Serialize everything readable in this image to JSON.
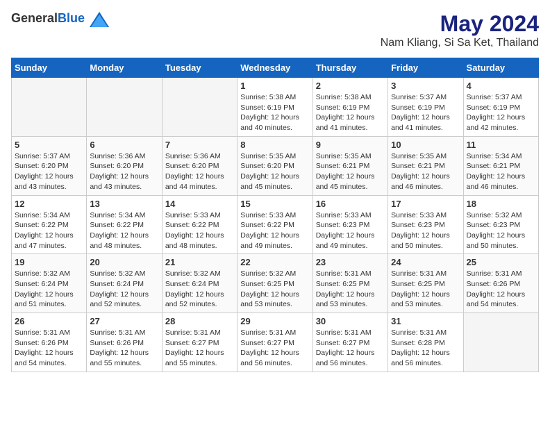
{
  "header": {
    "logo_general": "General",
    "logo_blue": "Blue",
    "month_title": "May 2024",
    "location": "Nam Kliang, Si Sa Ket, Thailand"
  },
  "weekdays": [
    "Sunday",
    "Monday",
    "Tuesday",
    "Wednesday",
    "Thursday",
    "Friday",
    "Saturday"
  ],
  "weeks": [
    [
      {
        "day": "",
        "info": ""
      },
      {
        "day": "",
        "info": ""
      },
      {
        "day": "",
        "info": ""
      },
      {
        "day": "1",
        "info": "Sunrise: 5:38 AM\nSunset: 6:19 PM\nDaylight: 12 hours\nand 40 minutes."
      },
      {
        "day": "2",
        "info": "Sunrise: 5:38 AM\nSunset: 6:19 PM\nDaylight: 12 hours\nand 41 minutes."
      },
      {
        "day": "3",
        "info": "Sunrise: 5:37 AM\nSunset: 6:19 PM\nDaylight: 12 hours\nand 41 minutes."
      },
      {
        "day": "4",
        "info": "Sunrise: 5:37 AM\nSunset: 6:19 PM\nDaylight: 12 hours\nand 42 minutes."
      }
    ],
    [
      {
        "day": "5",
        "info": "Sunrise: 5:37 AM\nSunset: 6:20 PM\nDaylight: 12 hours\nand 43 minutes."
      },
      {
        "day": "6",
        "info": "Sunrise: 5:36 AM\nSunset: 6:20 PM\nDaylight: 12 hours\nand 43 minutes."
      },
      {
        "day": "7",
        "info": "Sunrise: 5:36 AM\nSunset: 6:20 PM\nDaylight: 12 hours\nand 44 minutes."
      },
      {
        "day": "8",
        "info": "Sunrise: 5:35 AM\nSunset: 6:20 PM\nDaylight: 12 hours\nand 45 minutes."
      },
      {
        "day": "9",
        "info": "Sunrise: 5:35 AM\nSunset: 6:21 PM\nDaylight: 12 hours\nand 45 minutes."
      },
      {
        "day": "10",
        "info": "Sunrise: 5:35 AM\nSunset: 6:21 PM\nDaylight: 12 hours\nand 46 minutes."
      },
      {
        "day": "11",
        "info": "Sunrise: 5:34 AM\nSunset: 6:21 PM\nDaylight: 12 hours\nand 46 minutes."
      }
    ],
    [
      {
        "day": "12",
        "info": "Sunrise: 5:34 AM\nSunset: 6:22 PM\nDaylight: 12 hours\nand 47 minutes."
      },
      {
        "day": "13",
        "info": "Sunrise: 5:34 AM\nSunset: 6:22 PM\nDaylight: 12 hours\nand 48 minutes."
      },
      {
        "day": "14",
        "info": "Sunrise: 5:33 AM\nSunset: 6:22 PM\nDaylight: 12 hours\nand 48 minutes."
      },
      {
        "day": "15",
        "info": "Sunrise: 5:33 AM\nSunset: 6:22 PM\nDaylight: 12 hours\nand 49 minutes."
      },
      {
        "day": "16",
        "info": "Sunrise: 5:33 AM\nSunset: 6:23 PM\nDaylight: 12 hours\nand 49 minutes."
      },
      {
        "day": "17",
        "info": "Sunrise: 5:33 AM\nSunset: 6:23 PM\nDaylight: 12 hours\nand 50 minutes."
      },
      {
        "day": "18",
        "info": "Sunrise: 5:32 AM\nSunset: 6:23 PM\nDaylight: 12 hours\nand 50 minutes."
      }
    ],
    [
      {
        "day": "19",
        "info": "Sunrise: 5:32 AM\nSunset: 6:24 PM\nDaylight: 12 hours\nand 51 minutes."
      },
      {
        "day": "20",
        "info": "Sunrise: 5:32 AM\nSunset: 6:24 PM\nDaylight: 12 hours\nand 52 minutes."
      },
      {
        "day": "21",
        "info": "Sunrise: 5:32 AM\nSunset: 6:24 PM\nDaylight: 12 hours\nand 52 minutes."
      },
      {
        "day": "22",
        "info": "Sunrise: 5:32 AM\nSunset: 6:25 PM\nDaylight: 12 hours\nand 53 minutes."
      },
      {
        "day": "23",
        "info": "Sunrise: 5:31 AM\nSunset: 6:25 PM\nDaylight: 12 hours\nand 53 minutes."
      },
      {
        "day": "24",
        "info": "Sunrise: 5:31 AM\nSunset: 6:25 PM\nDaylight: 12 hours\nand 53 minutes."
      },
      {
        "day": "25",
        "info": "Sunrise: 5:31 AM\nSunset: 6:26 PM\nDaylight: 12 hours\nand 54 minutes."
      }
    ],
    [
      {
        "day": "26",
        "info": "Sunrise: 5:31 AM\nSunset: 6:26 PM\nDaylight: 12 hours\nand 54 minutes."
      },
      {
        "day": "27",
        "info": "Sunrise: 5:31 AM\nSunset: 6:26 PM\nDaylight: 12 hours\nand 55 minutes."
      },
      {
        "day": "28",
        "info": "Sunrise: 5:31 AM\nSunset: 6:27 PM\nDaylight: 12 hours\nand 55 minutes."
      },
      {
        "day": "29",
        "info": "Sunrise: 5:31 AM\nSunset: 6:27 PM\nDaylight: 12 hours\nand 56 minutes."
      },
      {
        "day": "30",
        "info": "Sunrise: 5:31 AM\nSunset: 6:27 PM\nDaylight: 12 hours\nand 56 minutes."
      },
      {
        "day": "31",
        "info": "Sunrise: 5:31 AM\nSunset: 6:28 PM\nDaylight: 12 hours\nand 56 minutes."
      },
      {
        "day": "",
        "info": ""
      }
    ]
  ]
}
